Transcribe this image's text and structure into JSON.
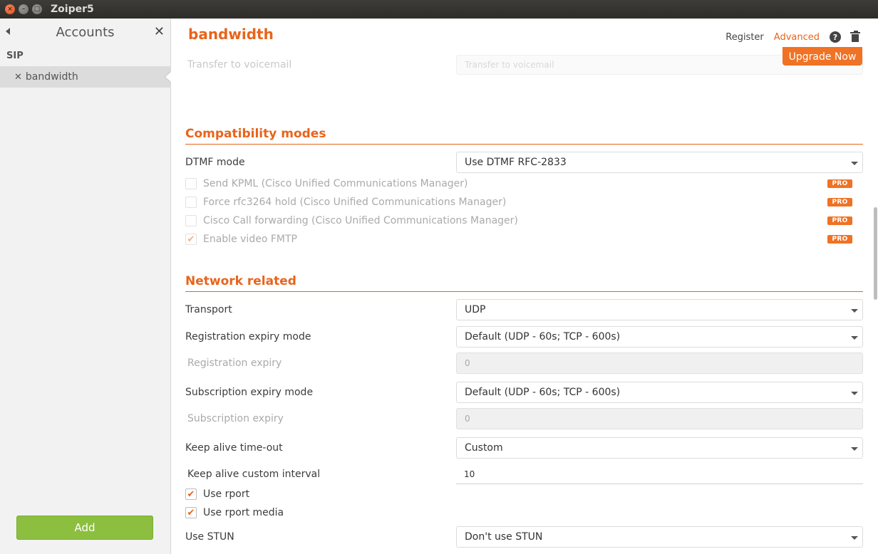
{
  "window": {
    "title": "Zoiper5"
  },
  "sidebar": {
    "title": "Accounts",
    "section": "SIP",
    "account": "bandwidth",
    "add_label": "Add"
  },
  "header": {
    "account_name": "bandwidth",
    "register_label": "Register",
    "advanced_label": "Advanced",
    "help_glyph": "?"
  },
  "upgrade_label": "Upgrade Now",
  "transfer": {
    "label": "Transfer to voicemail",
    "placeholder": "Transfer to voicemail"
  },
  "compat": {
    "title": "Compatibility modes",
    "dtmf_label": "DTMF mode",
    "dtmf_value": "Use DTMF RFC-2833",
    "pro_badge": "PRO",
    "options": [
      {
        "label": "Send KPML (Cisco Unified Communications Manager)",
        "checked": false
      },
      {
        "label": "Force rfc3264 hold (Cisco Unified Communications Manager)",
        "checked": false
      },
      {
        "label": "Cisco Call forwarding (Cisco Unified Communications Manager)",
        "checked": false
      },
      {
        "label": "Enable video FMTP",
        "checked": true
      }
    ]
  },
  "network": {
    "title": "Network related",
    "transport_label": "Transport",
    "transport_value": "UDP",
    "reg_mode_label": "Registration expiry mode",
    "reg_mode_value": "Default (UDP - 60s; TCP - 600s)",
    "reg_expiry_label": "Registration expiry",
    "reg_expiry_value": "0",
    "sub_mode_label": "Subscription expiry mode",
    "sub_mode_value": "Default (UDP - 60s; TCP - 600s)",
    "sub_expiry_label": "Subscription expiry",
    "sub_expiry_value": "0",
    "keepalive_label": "Keep alive time-out",
    "keepalive_value": "Custom",
    "keepalive_interval_label": "Keep alive custom interval",
    "keepalive_interval_value": "10",
    "rport_label": "Use rport",
    "rport_media_label": "Use rport media",
    "stun_label": "Use STUN",
    "stun_value": "Don't use STUN"
  },
  "colors": {
    "accent": "#e8641b",
    "add_button": "#8cbf3f",
    "pro_badge": "#f07224"
  }
}
